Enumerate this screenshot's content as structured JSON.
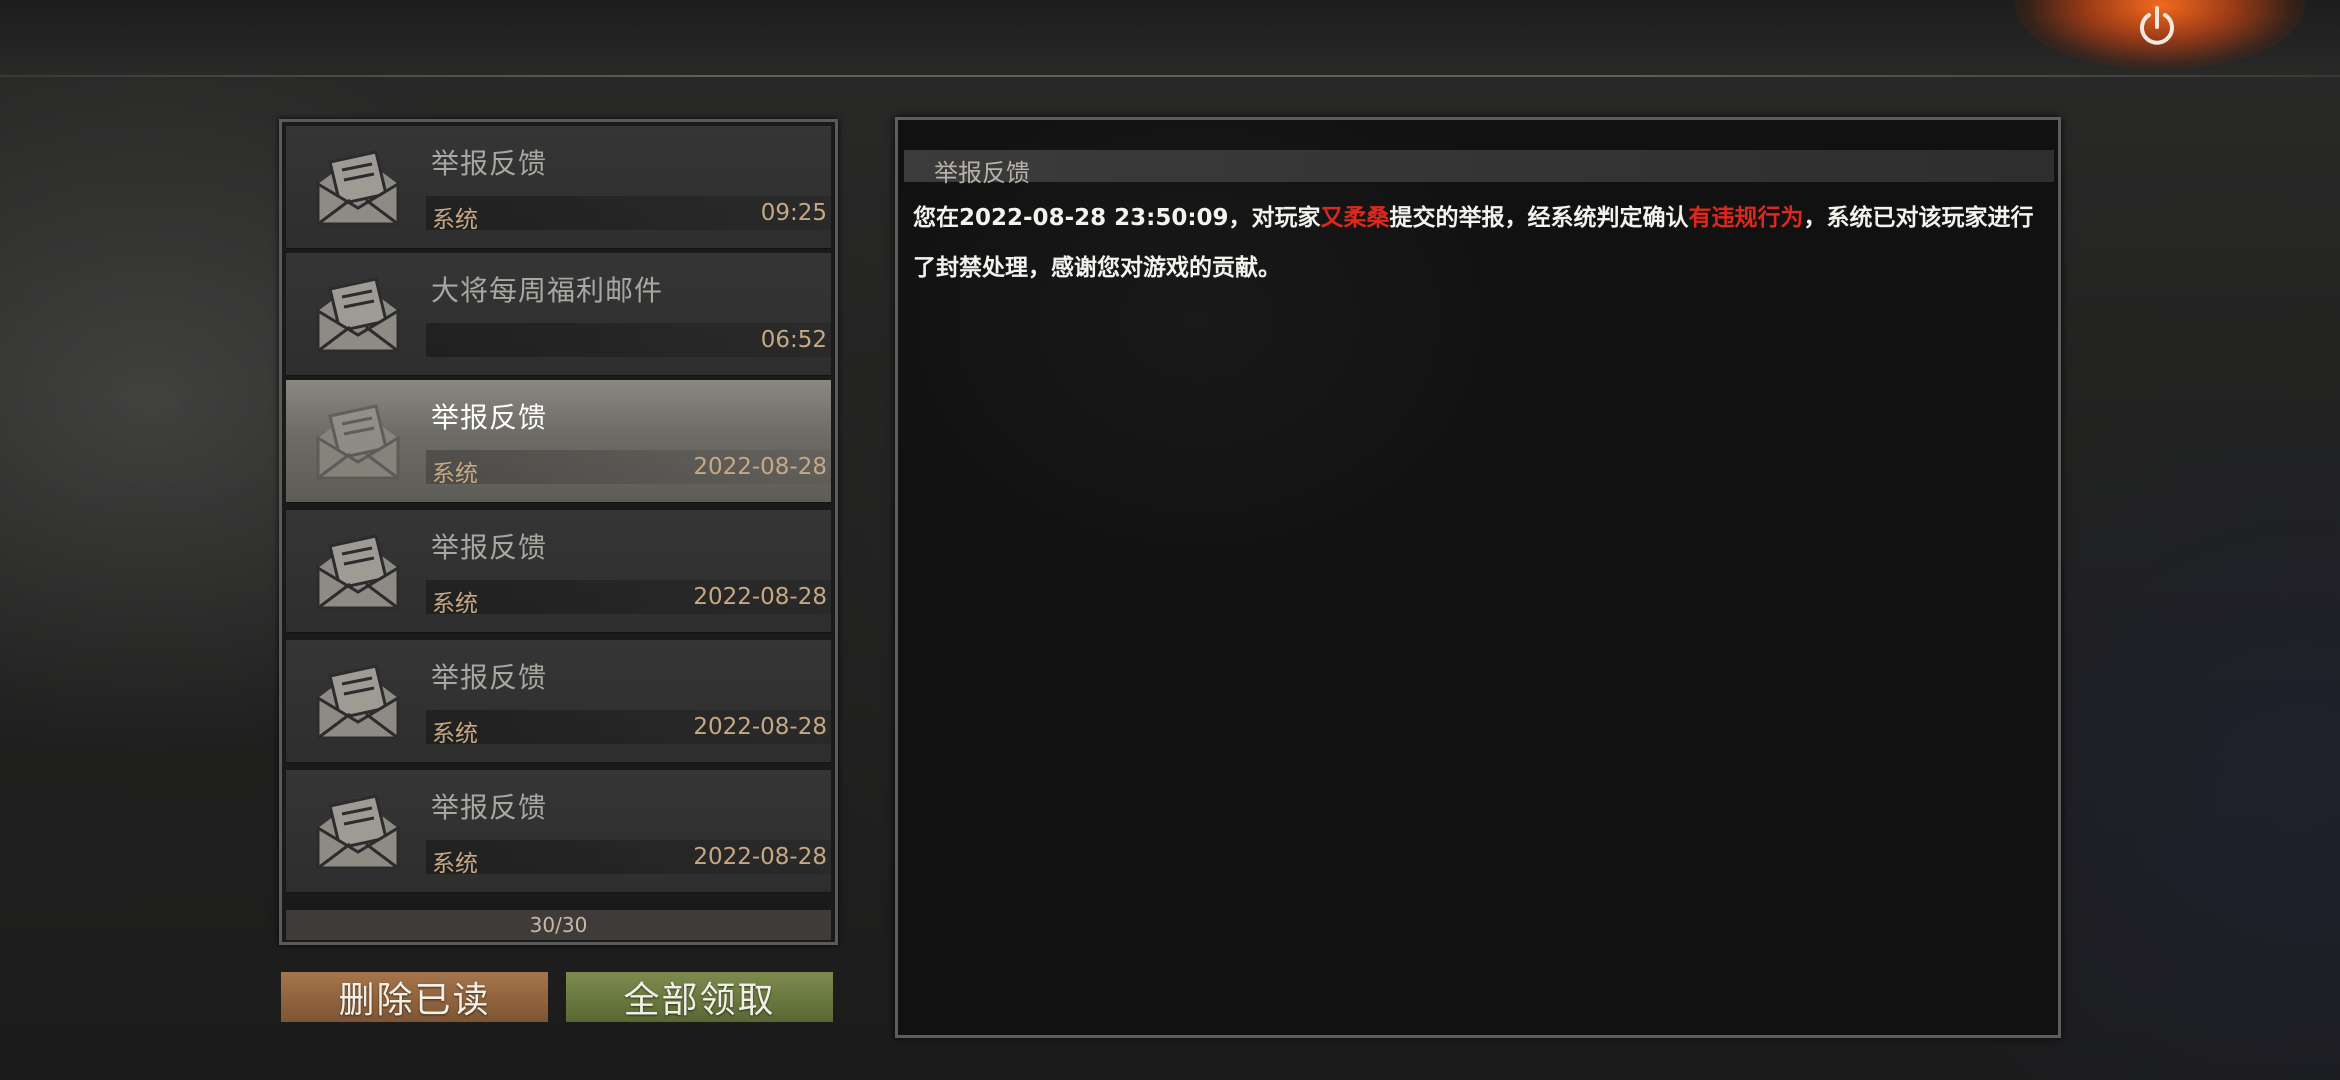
{
  "mail_list": {
    "items": [
      {
        "title": "举报反馈",
        "sender": "系统",
        "time": "09:25",
        "selected": false
      },
      {
        "title": "大将每周福利邮件",
        "sender": "",
        "time": "06:52",
        "selected": false
      },
      {
        "title": "举报反馈",
        "sender": "系统",
        "time": "2022-08-28",
        "selected": true
      },
      {
        "title": "举报反馈",
        "sender": "系统",
        "time": "2022-08-28",
        "selected": false
      },
      {
        "title": "举报反馈",
        "sender": "系统",
        "time": "2022-08-28",
        "selected": false
      },
      {
        "title": "举报反馈",
        "sender": "系统",
        "time": "2022-08-28",
        "selected": false
      }
    ],
    "count": "30/30"
  },
  "buttons": {
    "delete_read": "删除已读",
    "collect_all": "全部领取"
  },
  "content": {
    "title": "举报反馈",
    "part1": "您在2022-08-28 23:50:09，对玩家",
    "player": "又柔桑",
    "part2": "提交的举报，经系统判定确认",
    "verdict": "有违规行为",
    "part3": "，系统已对该玩家进行了封禁处理，感谢您对游戏的贡献。"
  },
  "colors": {
    "highlight": "#e0271c",
    "delete_button": "#93653f",
    "collect_button": "#6b7a41",
    "power_glow": "#ff6e1e"
  },
  "icons": {
    "power": "power-icon",
    "mail": "open-envelope-icon"
  }
}
